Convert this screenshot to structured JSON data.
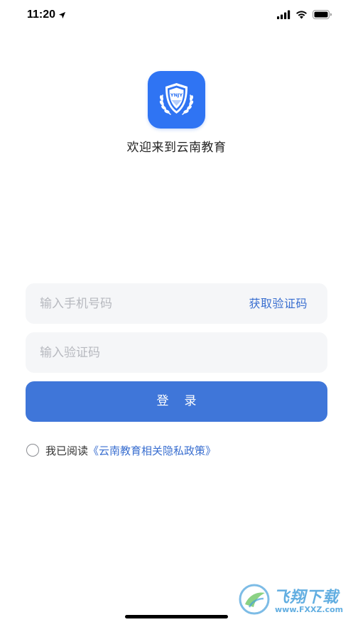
{
  "status_bar": {
    "time": "11:20",
    "icons": [
      "location-arrow-icon",
      "signal-icon",
      "wifi-icon",
      "battery-icon"
    ]
  },
  "logo": {
    "text": "YNJY",
    "color": "#2f74f3"
  },
  "welcome": {
    "title": "欢迎来到云南教育"
  },
  "form": {
    "phone_placeholder": "输入手机号码",
    "get_code_label": "获取验证码",
    "code_placeholder": "输入验证码",
    "login_label": "登录"
  },
  "agreement": {
    "prefix": "我已阅读",
    "policy_link": "《云南教育相关隐私政策》"
  },
  "watermark": {
    "title": "飞翔下载",
    "url": "www.FXXZ.com"
  },
  "colors": {
    "accent": "#3f76d9",
    "link": "#3a6fd0",
    "field_bg": "#f5f6f8",
    "placeholder": "#b7b9bf"
  }
}
